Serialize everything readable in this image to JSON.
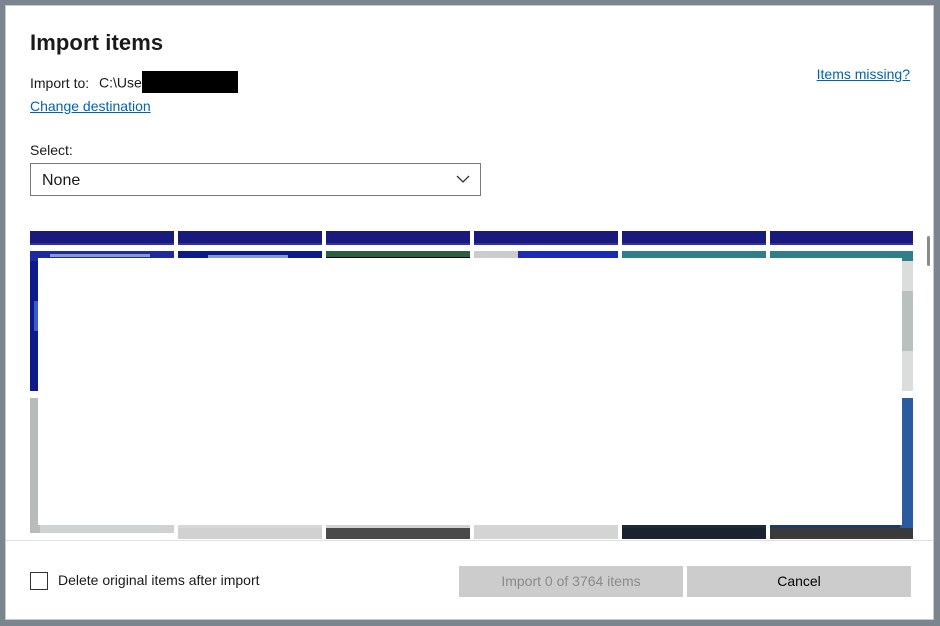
{
  "dialog": {
    "title": "Import items",
    "import_to_label": "Import to:",
    "import_to_path": "C:\\User",
    "change_destination": "Change destination",
    "items_missing": "Items missing?",
    "select_label": "Select:",
    "select_value": "None",
    "delete_label": "Delete original items after import",
    "import_button": "Import 0 of 3764 items",
    "cancel_button": "Cancel"
  },
  "thumbnail_grid": {
    "columns": 6,
    "visible_rows": 3
  },
  "colors": {
    "accent_link": "#0063b1",
    "button_bg": "#cccccc",
    "thumb_header_blue": "#1a1a7c"
  }
}
